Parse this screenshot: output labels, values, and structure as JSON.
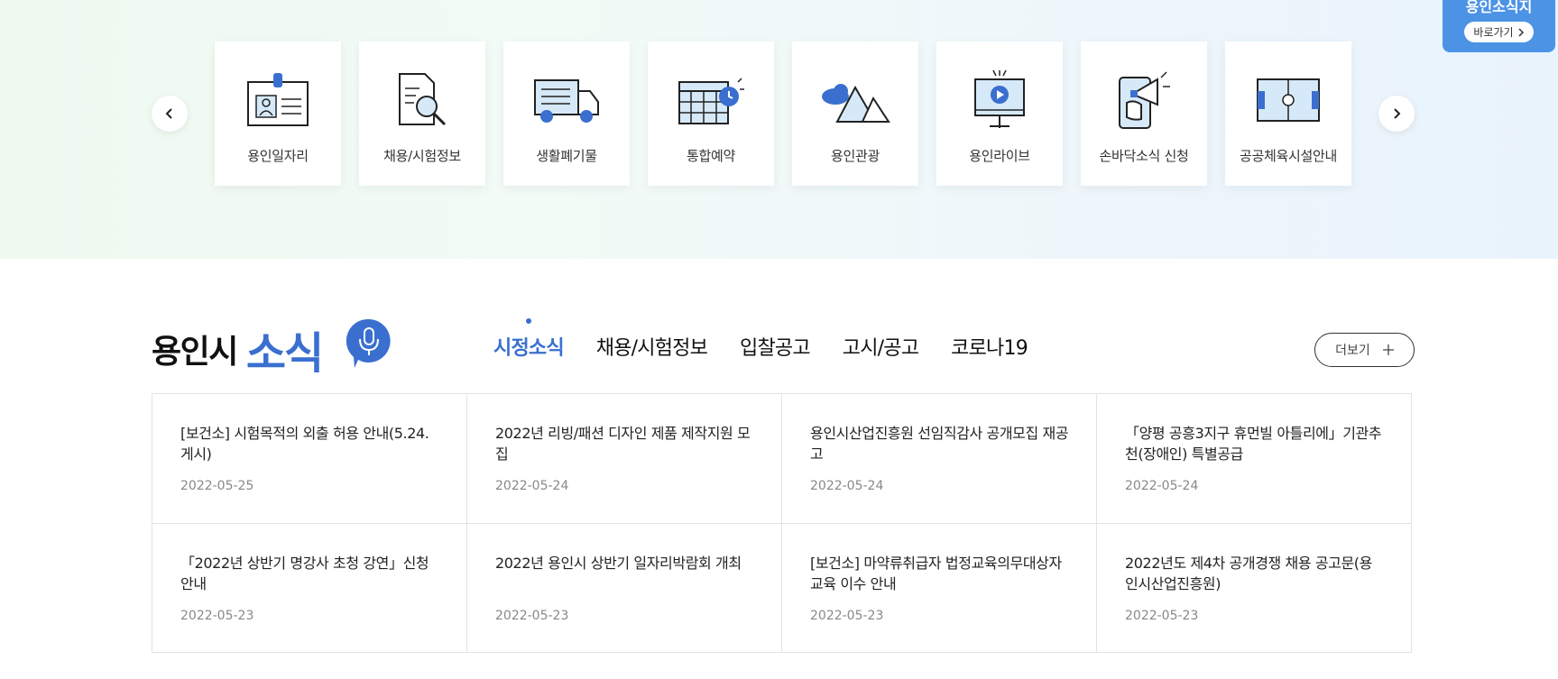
{
  "shortcut": {
    "title": "용인소식지",
    "button_label": "바로가기"
  },
  "services": [
    {
      "label": "용인일자리",
      "icon": "id-card-icon"
    },
    {
      "label": "채용/시험정보",
      "icon": "document-search-icon"
    },
    {
      "label": "생활폐기물",
      "icon": "truck-icon"
    },
    {
      "label": "통합예약",
      "icon": "calendar-icon"
    },
    {
      "label": "용인관광",
      "icon": "mountain-icon"
    },
    {
      "label": "용인라이브",
      "icon": "video-screen-icon"
    },
    {
      "label": "손바닥소식 신청",
      "icon": "phone-megaphone-icon"
    },
    {
      "label": "공공체육시설안내",
      "icon": "field-icon"
    }
  ],
  "news": {
    "title_part1": "용인시",
    "title_part2": "소식",
    "tabs": [
      {
        "label": "시정소식",
        "active": true
      },
      {
        "label": "채용/시험정보",
        "active": false
      },
      {
        "label": "입찰공고",
        "active": false
      },
      {
        "label": "고시/공고",
        "active": false
      },
      {
        "label": "코로나19",
        "active": false
      }
    ],
    "more_label": "더보기",
    "items": [
      {
        "title": "[보건소] 시험목적의 외출 허용 안내(5.24. 게시)",
        "date": "2022-05-25"
      },
      {
        "title": "2022년 리빙/패션 디자인 제품 제작지원 모집",
        "date": "2022-05-24"
      },
      {
        "title": "용인시산업진흥원 선임직감사 공개모집 재공고",
        "date": "2022-05-24"
      },
      {
        "title": "「양평 공흥3지구 휴먼빌 아틀리에」기관추천(장애인) 특별공급",
        "date": "2022-05-24"
      },
      {
        "title": "「2022년 상반기 명강사 초청 강연」신청 안내",
        "date": "2022-05-23"
      },
      {
        "title": "2022년 용인시 상반기 일자리박람회 개최",
        "date": "2022-05-23"
      },
      {
        "title": "[보건소] 마약류취급자 법정교육의무대상자 교육 이수 안내",
        "date": "2022-05-23"
      },
      {
        "title": "2022년도 제4차 공개경쟁 채용 공고문(용인시산업진흥원)",
        "date": "2022-05-23"
      }
    ]
  },
  "colors": {
    "accent": "#3a6fcf",
    "shortcut_bg": "#4c93e6",
    "icon_fill": "#d6e9f8",
    "icon_blue": "#3a6fcf"
  }
}
